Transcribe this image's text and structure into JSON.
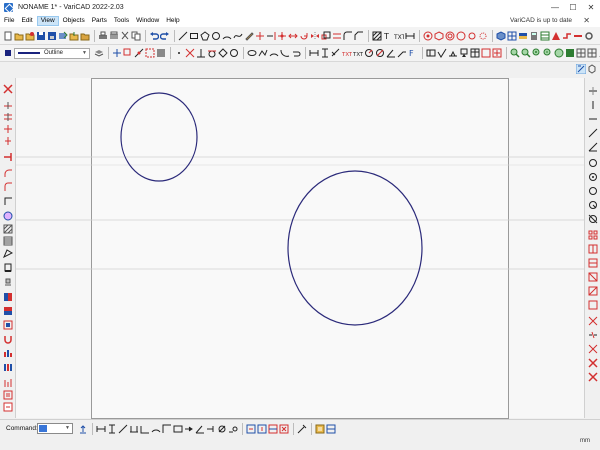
{
  "window": {
    "title": "NONAME 1* - VariCAD 2022-2.03",
    "app_icon": "varicad-icon",
    "controls": {
      "minimize": "—",
      "maximize": "☐",
      "close": "✕"
    }
  },
  "menu": {
    "items": [
      "File",
      "Edit",
      "View",
      "Objects",
      "Parts",
      "Tools",
      "Window",
      "Help"
    ],
    "active": "View",
    "update_notice": "VariCAD is up to date",
    "close_glyph": "✕"
  },
  "line_style": {
    "label": "Outline",
    "color": "#1a237e"
  },
  "command": {
    "label": "Command:",
    "value": ""
  },
  "status": {
    "units": "mm"
  },
  "drawing": {
    "objects": [
      {
        "type": "ellipse",
        "name": "small-circle"
      },
      {
        "type": "ellipse",
        "name": "large-circle"
      }
    ],
    "stroke_color": "#2b2a7a"
  },
  "colors": {
    "accent": "#d32f2f",
    "icon_blue": "#1f4fa8",
    "icon_green": "#2e7d32",
    "selection": "#cce4f7"
  }
}
